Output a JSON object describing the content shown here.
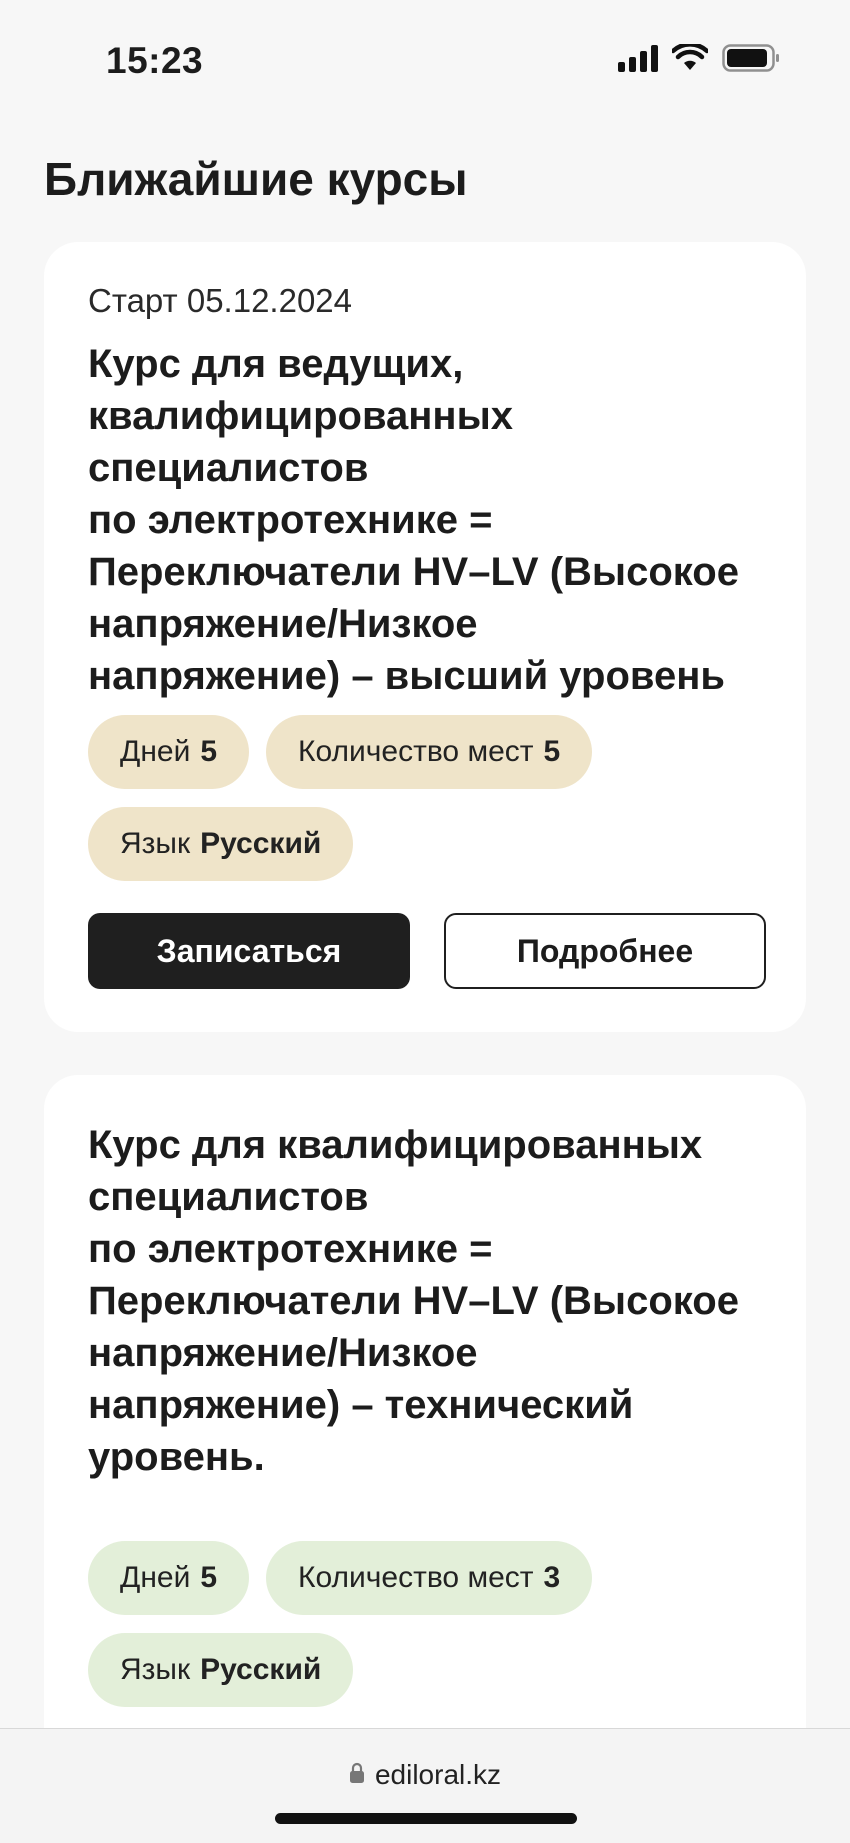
{
  "status_bar": {
    "time": "15:23"
  },
  "page": {
    "title": "Ближайшие курсы"
  },
  "courses": [
    {
      "start": "Старт 05.12.2024",
      "title": "Курс для ведущих,\nквалифицированных\nспециалистов\nпо электротехнике =\nПереключатели HV–LV (Высокое\nнапряжение/Низкое\nнапряжение) – высший уровень",
      "chips": [
        {
          "label": "Дней",
          "value": "5"
        },
        {
          "label": "Количество мест",
          "value": "5"
        },
        {
          "label": "Язык",
          "value": "Русский"
        }
      ],
      "chip_color": "#efe4c9",
      "buttons": {
        "enroll": "Записаться",
        "details": "Подробнее"
      }
    },
    {
      "title": "Курс для квалифицированных\nспециалистов\nпо электротехнике =\nПереключатели HV–LV (Высокое\nнапряжение/Низкое\nнапряжение) – технический\nуровень.",
      "chips": [
        {
          "label": "Дней",
          "value": "5"
        },
        {
          "label": "Количество мест",
          "value": "3"
        },
        {
          "label": "Язык",
          "value": "Русский"
        }
      ],
      "chip_color": "#e3efd9"
    }
  ],
  "browser": {
    "url": "ediloral.kz",
    "lock_icon": "lock-icon"
  },
  "colors": {
    "background": "#f7f7f7",
    "card": "#ffffff",
    "primary_button": "#1f1f1f"
  }
}
